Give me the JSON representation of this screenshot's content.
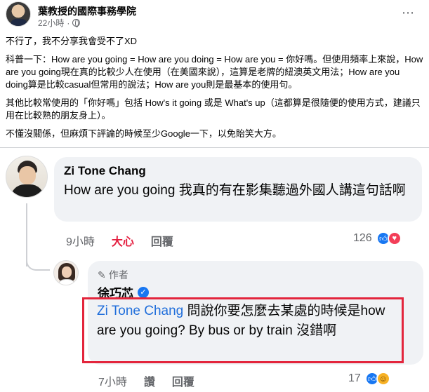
{
  "post": {
    "page_name": "葉教授的國際事務學院",
    "time": "22小時",
    "paragraphs": [
      "不行了，我不分享我會受不了XD",
      "科普一下：How are you going = How are you doing = How are you = 你好嗎。但使用頻率上來說，How are you going現在真的比較少人在使用（在美國來說），這算是老牌的紐澳英文用法；How are you doing算是比較casual但常用的說法；How are you則是最基本的使用句。",
      "其他比較常使用的「你好嗎」包括 How's it going 或是 What's up（這都算是很隨便的使用方式，建議只用在比較熟的朋友身上）。",
      "不懂沒關係，但麻煩下評論的時候至少Google一下，以免貽笑大方。"
    ],
    "more_icon": "⋯"
  },
  "comment1": {
    "author": "Zi Tone Chang",
    "text": "How are you going 我真的有在影集聽過外國人講這句話啊",
    "time": "9小時",
    "reaction_label": "大心",
    "reply_label": "回覆",
    "reaction_count": "126",
    "reactions": [
      "like-icon",
      "love-icon"
    ]
  },
  "comment2": {
    "author_tag": "作者",
    "author": "徐巧芯",
    "mention": "Zi Tone Chang",
    "text": " 問說你要怎麼去某處的時候是how are you going? By bus or by train 沒錯啊",
    "time": "7小時",
    "like_label": "讚",
    "reply_label": "回覆",
    "reaction_count": "17",
    "reactions": [
      "like-icon",
      "haha-icon"
    ]
  },
  "colors": {
    "link": "#216fdb",
    "love": "#e41e3f",
    "highlight_border": "#e3253c",
    "bubble": "#f0f2f5",
    "secondary_text": "#65676b"
  }
}
